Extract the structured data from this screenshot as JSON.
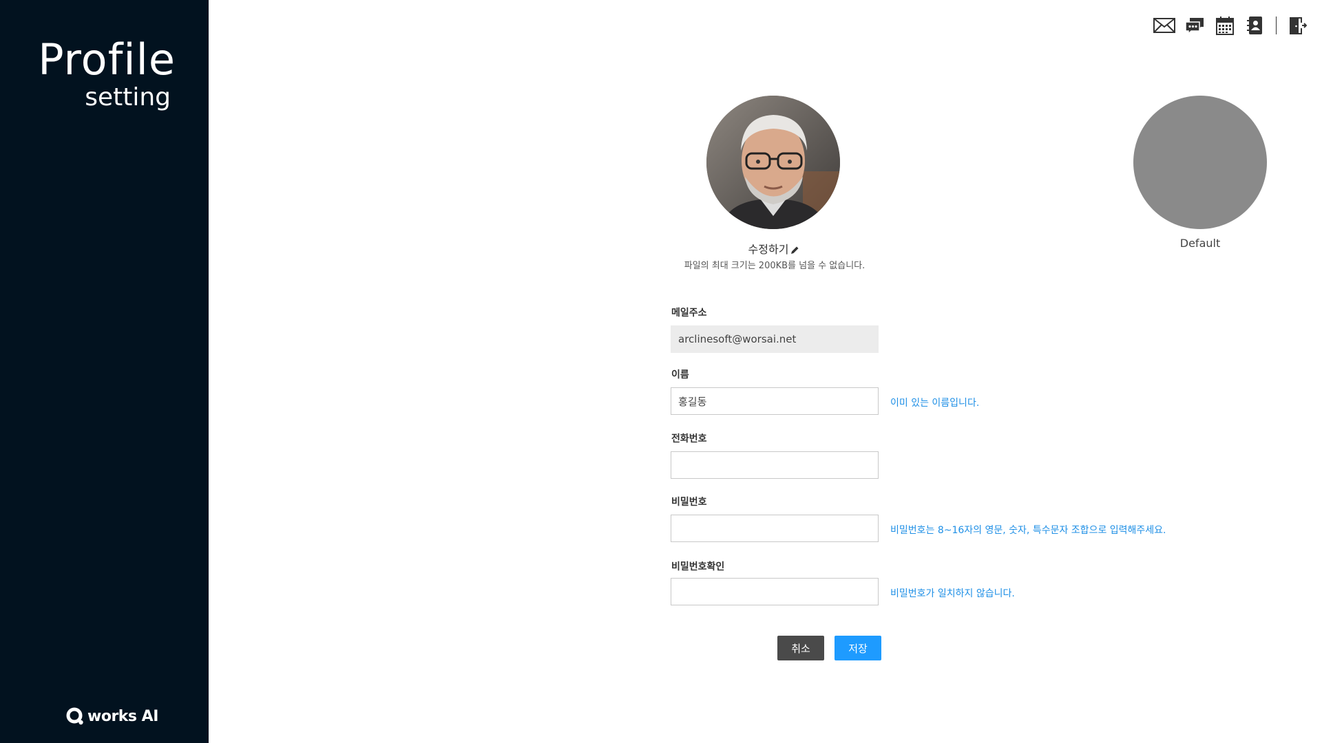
{
  "sidebar": {
    "title": "Profile",
    "subtitle": "setting",
    "logo_text": "works AI"
  },
  "topbar": {
    "icons": [
      "mail-icon",
      "chat-icon",
      "calendar-icon",
      "contacts-icon",
      "logout-icon"
    ]
  },
  "profile": {
    "edit_label": "수정하기",
    "file_hint": "파일의 최대 크기는 200KB를 넘을 수 없습니다.",
    "default_label": "Default"
  },
  "form": {
    "email": {
      "label": "메일주소",
      "value": "arclinesoft@worsai.net"
    },
    "name": {
      "label": "이름",
      "value": "홍길동",
      "hint": "이미 있는 이름입니다."
    },
    "phone": {
      "label": "전화번호",
      "value": ""
    },
    "password": {
      "label": "비밀번호",
      "value": "",
      "hint": "비밀번호는 8~16자의 영문, 숫자, 특수문자 조합으로 입력해주세요."
    },
    "password_confirm": {
      "label": "비밀번호확인",
      "value": "",
      "hint": "비밀번호가 일치하지 않습니다."
    }
  },
  "buttons": {
    "cancel": "취소",
    "save": "저장"
  },
  "colors": {
    "sidebar_bg": "#02121f",
    "accent": "#1e9bff",
    "hint": "#1e8fe6",
    "cancel_bg": "#4a4a4a",
    "default_avatar": "#8a8a8a"
  }
}
